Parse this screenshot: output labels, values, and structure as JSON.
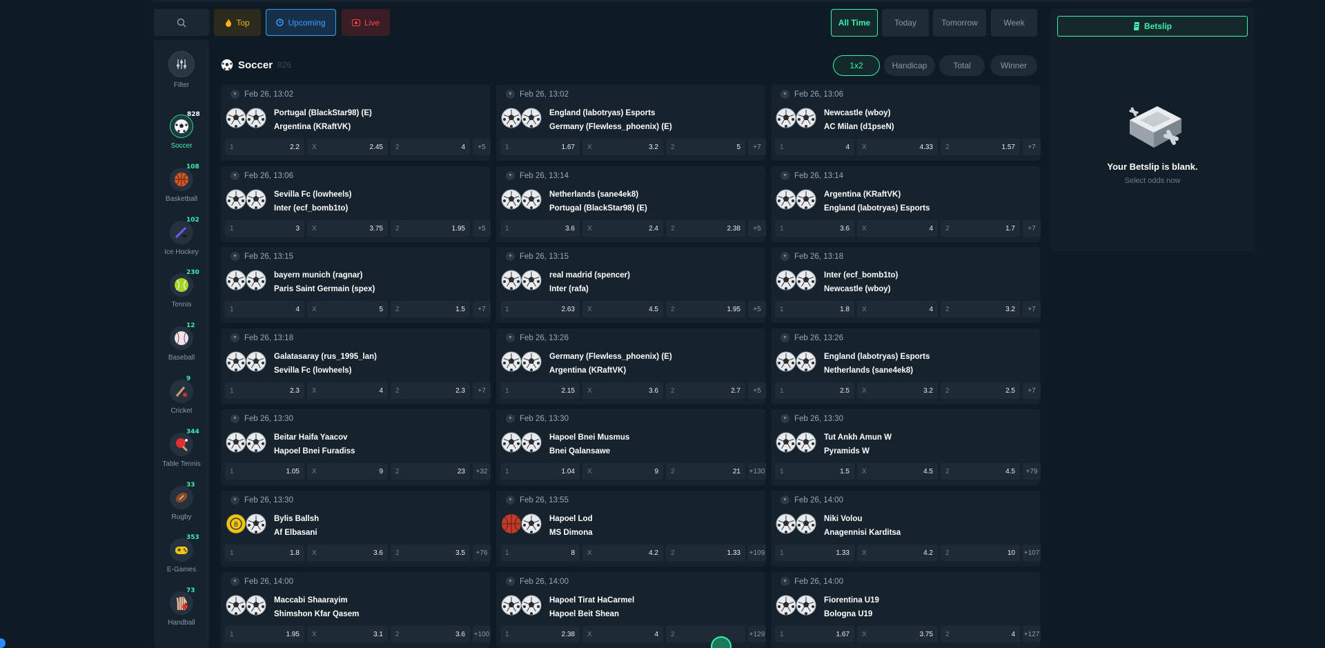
{
  "topbar": {
    "filters": [
      {
        "label": "Top",
        "icon": "fire-icon"
      },
      {
        "label": "Upcoming",
        "icon": "clock-icon"
      },
      {
        "label": "Live",
        "icon": "live-icon"
      }
    ],
    "time_ranges": [
      "All Time",
      "Today",
      "Tomorrow",
      "Week"
    ],
    "active_time_range": "All Time"
  },
  "sidebar": {
    "filter_label": "Filter",
    "sports": [
      {
        "label": "Soccer",
        "count": "828",
        "icon": "soccer-ball-icon",
        "active": true
      },
      {
        "label": "Basketball",
        "count": "108",
        "icon": "basketball-icon"
      },
      {
        "label": "Ice Hockey",
        "count": "102",
        "icon": "ice-hockey-icon"
      },
      {
        "label": "Tennis",
        "count": "230",
        "icon": "tennis-ball-icon"
      },
      {
        "label": "Baseball",
        "count": "12",
        "icon": "baseball-icon"
      },
      {
        "label": "Cricket",
        "count": "9",
        "icon": "cricket-icon"
      },
      {
        "label": "Table Tennis",
        "count": "344",
        "icon": "table-tennis-icon"
      },
      {
        "label": "Rugby",
        "count": "33",
        "icon": "rugby-ball-icon"
      },
      {
        "label": "E-Games",
        "count": "353",
        "icon": "gamepad-icon"
      },
      {
        "label": "Handball",
        "count": "73",
        "icon": "handball-icon"
      }
    ]
  },
  "main": {
    "title": "Soccer",
    "count": "826",
    "markets": [
      "1x2",
      "Handicap",
      "Total",
      "Winner"
    ],
    "active_market": "1x2",
    "matches": [
      {
        "date": "Feb 26, 13:02",
        "home": "Portugal (BlackStar98) (E)",
        "away": "Argentina (KRaftVK)",
        "o1": "2.2",
        "ox": "2.45",
        "o2": "4",
        "more": "+5"
      },
      {
        "date": "Feb 26, 13:02",
        "home": "England (labotryas) Esports",
        "away": "Germany (Flewless_phoenix) (E)",
        "o1": "1.67",
        "ox": "3.2",
        "o2": "5",
        "more": "+7"
      },
      {
        "date": "Feb 26, 13:06",
        "home": "Newcastle (wboy)",
        "away": "AC Milan (d1pseN)",
        "o1": "4",
        "ox": "4.33",
        "o2": "1.57",
        "more": "+7"
      },
      {
        "date": "Feb 26, 13:06",
        "home": "Sevilla Fc (lowheels)",
        "away": "Inter (ecf_bomb1to)",
        "o1": "3",
        "ox": "3.75",
        "o2": "1.95",
        "more": "+5"
      },
      {
        "date": "Feb 26, 13:14",
        "home": "Netherlands (sane4ek8)",
        "away": "Portugal (BlackStar98) (E)",
        "o1": "3.6",
        "ox": "2.4",
        "o2": "2.38",
        "more": "+5"
      },
      {
        "date": "Feb 26, 13:14",
        "home": "Argentina (KRaftVK)",
        "away": "England (labotryas) Esports",
        "o1": "3.6",
        "ox": "4",
        "o2": "1.7",
        "more": "+7"
      },
      {
        "date": "Feb 26, 13:15",
        "home": "bayern munich (ragnar)",
        "away": "Paris Saint Germain (spex)",
        "o1": "4",
        "ox": "5",
        "o2": "1.5",
        "more": "+7"
      },
      {
        "date": "Feb 26, 13:15",
        "home": "real madrid (spencer)",
        "away": "Inter (rafa)",
        "o1": "2.63",
        "ox": "4.5",
        "o2": "1.95",
        "more": "+5"
      },
      {
        "date": "Feb 26, 13:18",
        "home": "Inter (ecf_bomb1to)",
        "away": "Newcastle (wboy)",
        "o1": "1.8",
        "ox": "4",
        "o2": "3.2",
        "more": "+7"
      },
      {
        "date": "Feb 26, 13:18",
        "home": "Galatasaray (rus_1995_lan)",
        "away": "Sevilla Fc (lowheels)",
        "o1": "2.3",
        "ox": "4",
        "o2": "2.3",
        "more": "+7"
      },
      {
        "date": "Feb 26, 13:26",
        "home": "Germany (Flewless_phoenix) (E)",
        "away": "Argentina (KRaftVK)",
        "o1": "2.15",
        "ox": "3.6",
        "o2": "2.7",
        "more": "+5"
      },
      {
        "date": "Feb 26, 13:26",
        "home": "England (labotryas) Esports",
        "away": "Netherlands (sane4ek8)",
        "o1": "2.5",
        "ox": "3.2",
        "o2": "2.5",
        "more": "+7"
      },
      {
        "date": "Feb 26, 13:30",
        "home": "Beitar Haifa Yaacov",
        "away": "Hapoel Bnei Furadiss",
        "o1": "1.05",
        "ox": "9",
        "o2": "23",
        "more": "+32"
      },
      {
        "date": "Feb 26, 13:30",
        "home": "Hapoel Bnei Musmus",
        "away": "Bnei Qalansawe",
        "o1": "1.04",
        "ox": "9",
        "o2": "21",
        "more": "+130"
      },
      {
        "date": "Feb 26, 13:30",
        "home": "Tut Ankh Amun W",
        "away": "Pyramids W",
        "o1": "1.5",
        "ox": "4.5",
        "o2": "4.5",
        "more": "+79"
      },
      {
        "date": "Feb 26, 13:30",
        "home": "Bylis Ballsh",
        "away": "Af Elbasani",
        "o1": "1.8",
        "ox": "3.6",
        "o2": "3.5",
        "more": "+76"
      },
      {
        "date": "Feb 26, 13:55",
        "home": "Hapoel Lod",
        "away": "MS Dimona",
        "o1": "8",
        "ox": "4.2",
        "o2": "1.33",
        "more": "+109"
      },
      {
        "date": "Feb 26, 14:00",
        "home": "Niki Volou",
        "away": "Anagennisi Karditsa",
        "o1": "1.33",
        "ox": "4.2",
        "o2": "10",
        "more": "+107"
      },
      {
        "date": "Feb 26, 14:00",
        "home": "Maccabi Shaarayim",
        "away": "Shimshon Kfar Qasem",
        "o1": "1.95",
        "ox": "3.1",
        "o2": "3.6",
        "more": "+100"
      },
      {
        "date": "Feb 26, 14:00",
        "home": "Hapoel Tirat HaCarmel",
        "away": "Hapoel Beit Shean",
        "o1": "2.38",
        "ox": "4",
        "o2": "",
        "more": "+129"
      },
      {
        "date": "Feb 26, 14:00",
        "home": "Fiorentina U19",
        "away": "Bologna U19",
        "o1": "1.67",
        "ox": "3.75",
        "o2": "4",
        "more": "+127"
      }
    ]
  },
  "odds_keys": {
    "home": "1",
    "draw": "X",
    "away": "2"
  },
  "betslip": {
    "button_label": "Betslip",
    "empty_title": "Your Betslip is blank.",
    "empty_subtitle": "Select odds now"
  },
  "colors": {
    "accent": "#3df0b0",
    "background": "#0f1b24",
    "card": "#16232d",
    "upcoming": "#3aa0ff",
    "live": "#ff4a4a",
    "top": "#f4b41a"
  }
}
